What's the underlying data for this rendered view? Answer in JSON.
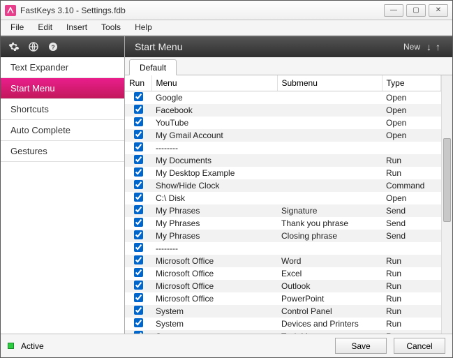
{
  "window": {
    "title": "FastKeys 3.10  -  Settings.fdb"
  },
  "menubar": [
    "File",
    "Edit",
    "Insert",
    "Tools",
    "Help"
  ],
  "sidebar": {
    "items": [
      {
        "label": "Text Expander"
      },
      {
        "label": "Start Menu"
      },
      {
        "label": "Shortcuts"
      },
      {
        "label": "Auto Complete"
      },
      {
        "label": "Gestures"
      }
    ],
    "active_index": 1
  },
  "main": {
    "title": "Start Menu",
    "new_label": "New",
    "tab_label": "Default",
    "columns": [
      "Run",
      "Menu",
      "Submenu",
      "Type"
    ],
    "rows": [
      {
        "run": true,
        "menu": "Google",
        "submenu": "",
        "type": "Open"
      },
      {
        "run": true,
        "menu": "Facebook",
        "submenu": "",
        "type": "Open"
      },
      {
        "run": true,
        "menu": "YouTube",
        "submenu": "",
        "type": "Open"
      },
      {
        "run": true,
        "menu": "My Gmail Account",
        "submenu": "",
        "type": "Open"
      },
      {
        "run": true,
        "menu": "--------",
        "submenu": "",
        "type": ""
      },
      {
        "run": true,
        "menu": "My Documents",
        "submenu": "",
        "type": "Run"
      },
      {
        "run": true,
        "menu": "My Desktop Example",
        "submenu": "",
        "type": "Run"
      },
      {
        "run": true,
        "menu": "Show/Hide Clock",
        "submenu": "",
        "type": "Command"
      },
      {
        "run": true,
        "menu": "C:\\ Disk",
        "submenu": "",
        "type": "Open"
      },
      {
        "run": true,
        "menu": "My Phrases",
        "submenu": "Signature",
        "type": "Send"
      },
      {
        "run": true,
        "menu": "My Phrases",
        "submenu": "Thank you phrase",
        "type": "Send"
      },
      {
        "run": true,
        "menu": "My Phrases",
        "submenu": "Closing phrase",
        "type": "Send"
      },
      {
        "run": true,
        "menu": "--------",
        "submenu": "",
        "type": ""
      },
      {
        "run": true,
        "menu": "Microsoft Office",
        "submenu": "Word",
        "type": "Run"
      },
      {
        "run": true,
        "menu": "Microsoft Office",
        "submenu": "Excel",
        "type": "Run"
      },
      {
        "run": true,
        "menu": "Microsoft Office",
        "submenu": "Outlook",
        "type": "Run"
      },
      {
        "run": true,
        "menu": "Microsoft Office",
        "submenu": "PowerPoint",
        "type": "Run"
      },
      {
        "run": true,
        "menu": "System",
        "submenu": "Control Panel",
        "type": "Run"
      },
      {
        "run": true,
        "menu": "System",
        "submenu": "Devices and Printers",
        "type": "Run"
      },
      {
        "run": true,
        "menu": "System",
        "submenu": "Task Manager",
        "type": "Run"
      }
    ]
  },
  "footer": {
    "status": "Active",
    "save": "Save",
    "cancel": "Cancel"
  }
}
